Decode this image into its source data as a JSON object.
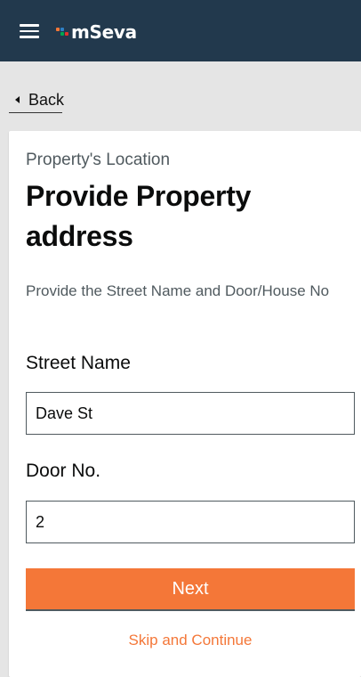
{
  "header": {
    "menu_icon": "hamburger-menu-icon",
    "brand": "mSeva",
    "colors": {
      "bar": "#22394d",
      "logo_dots": [
        "#f47738",
        "#2f80c5",
        "#00a850",
        "#e4322b"
      ]
    }
  },
  "nav": {
    "back_label": "Back",
    "back_icon": "triangle-left-icon"
  },
  "form": {
    "subheading": "Property's Location",
    "title": "Provide Property address",
    "description": "Provide the Street Name and Door/House No",
    "street_label": "Street Name",
    "street_value": "Dave St",
    "door_label": "Door No.",
    "door_value": "2",
    "next_label": "Next",
    "skip_label": "Skip and Continue"
  },
  "colors": {
    "accent": "#f47738",
    "text": "#0b0c0c",
    "secondary_text": "#505a5f"
  }
}
